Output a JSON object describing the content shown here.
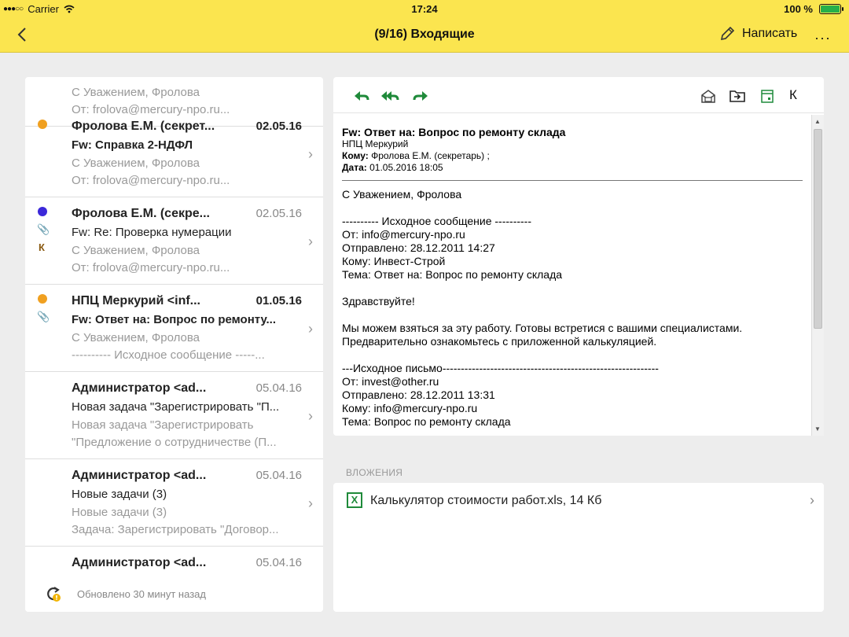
{
  "status_bar": {
    "carrier": "Carrier",
    "time": "17:24",
    "battery": "100 %"
  },
  "nav": {
    "title": "(9/16) Входящие",
    "compose_label": "Написать",
    "more_icon": "···"
  },
  "messages": [
    {
      "sender": "",
      "date": "",
      "subject": "",
      "line3": "С Уважением, Фролова",
      "line4": "От: frolova@mercury-npo.ru..."
    },
    {
      "sender": "Фролова Е.М. (секрет...",
      "date": "02.05.16",
      "subject": "Fw: Справка 2-НДФЛ",
      "line3": "С Уважением, Фролова",
      "line4": "От: frolova@mercury-npo.ru..."
    },
    {
      "sender": "Фролова Е.М. (секре...",
      "date": "02.05.16",
      "subject": "Fw: Re: Проверка нумерации",
      "line3": "С Уважением, Фролова",
      "line4": "От: frolova@mercury-npo.ru...",
      "k_label": "К"
    },
    {
      "sender": "НПЦ Меркурий <inf...",
      "date": "01.05.16",
      "subject": "Fw: Ответ на: Вопрос по ремонту...",
      "line3": "С Уважением, Фролова",
      "line4": "---------- Исходное сообщение -----..."
    },
    {
      "sender": "Администратор <ad...",
      "date": "05.04.16",
      "subject": "Новая задача \"Зарегистрировать \"П...",
      "line3": "Новая задача \"Зарегистрировать",
      "line4": "\"Предложение о сотрудничестве (П..."
    },
    {
      "sender": "Администратор <ad...",
      "date": "05.04.16",
      "subject": "Новые задачи (3)",
      "line3": "Новые задачи (3)",
      "line4": "Задача: Зарегистрировать \"Договор..."
    },
    {
      "sender": "Администратор <ad...",
      "date": "05.04.16",
      "subject": "",
      "line3": "",
      "line4": ""
    }
  ],
  "list_footer": {
    "updated": "Обновлено 30 минут назад"
  },
  "toolbar": {
    "k_label": "К"
  },
  "mail": {
    "subject": "Fw: Ответ на: Вопрос по ремонту склада",
    "from": "НПЦ Меркурий",
    "to_label": "Кому:",
    "to_value": "Фролова Е.М. (секретарь) ;",
    "date_label": "Дата:",
    "date_value": "01.05.2016 18:05",
    "body": "С Уважением, Фролова\n\n---------- Исходное сообщение ----------\nОт: info@mercury-npo.ru\nОтправлено: 28.12.2011 14:27\nКому: Инвест-Строй\nТема: Ответ на: Вопрос по ремонту склада\n\nЗдравствуйте!\n\nМы можем взяться за эту работу. Готовы встретися с вашими специалистами.\nПредварительно ознакомьтесь с приложенной калькуляцией.\n\n---Исходное письмо-----------------------------------------------------------\nОт: invest@other.ru\nОтправлено: 28.12.2011 13:31\nКому: info@mercury-npo.ru\nТема: Вопрос по ремонту склада"
  },
  "attachments": {
    "label": "ВЛОЖЕНИЯ",
    "items": [
      {
        "name": "Калькулятор стоимости работ.xls, 14 Кб",
        "icon": "excel-icon"
      }
    ]
  },
  "colors": {
    "nav_bg": "#fbe54f",
    "accent_green": "#1f8a3a",
    "unread_orange": "#f0a020",
    "flag_blue": "#3b28d9"
  }
}
